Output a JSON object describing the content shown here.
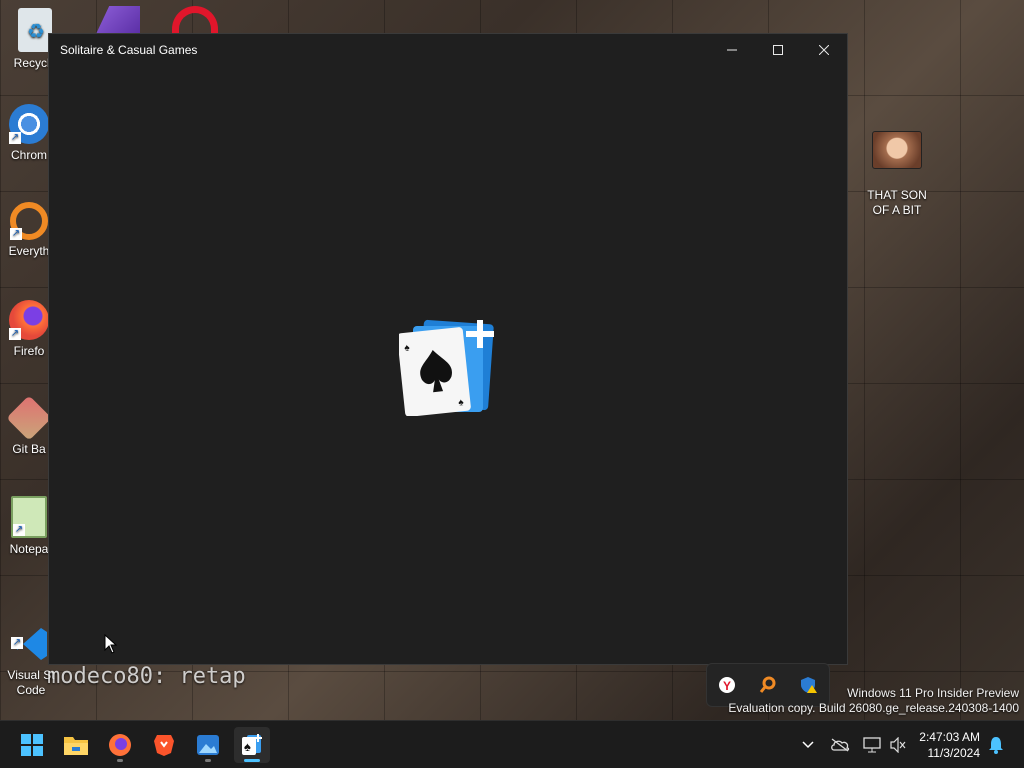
{
  "desktop": {
    "icons": [
      {
        "label": "Recycle",
        "icon": "recycle-bin-icon"
      },
      {
        "label": "Chrom",
        "icon": "chrome-icon"
      },
      {
        "label": "Everyth",
        "icon": "everything-search-icon"
      },
      {
        "label": "Firefo",
        "icon": "firefox-icon"
      },
      {
        "label": "Git Ba",
        "icon": "git-bash-icon"
      },
      {
        "label": "Notepa",
        "icon": "notepad-icon"
      },
      {
        "label": "Visual St\nCode",
        "icon": "vscode-icon"
      }
    ],
    "right_icon": {
      "label": "THAT SON\nOF A BIT",
      "icon": "photo-thumbnail-icon"
    }
  },
  "window": {
    "title": "Solitaire & Casual Games",
    "minimize_symbol": "—",
    "maximize_symbol": "☐",
    "close_symbol": "✕",
    "splash_icon": "solitaire-logo-icon"
  },
  "overlay_text": "modeco80: retap",
  "watermark": {
    "line1": "Windows 11 Pro Insider Preview",
    "line2": "Evaluation copy. Build 26080.ge_release.240308-1400"
  },
  "tray_flyout": {
    "icons": [
      "yandex-icon",
      "everything-search-icon",
      "defender-warning-icon"
    ]
  },
  "taskbar": {
    "apps": [
      {
        "name": "start-button",
        "icon": "windows-start-icon"
      },
      {
        "name": "file-explorer",
        "icon": "folder-icon"
      },
      {
        "name": "firefox",
        "icon": "firefox-icon"
      },
      {
        "name": "brave",
        "icon": "brave-icon"
      },
      {
        "name": "photos",
        "icon": "photos-icon"
      },
      {
        "name": "solitaire",
        "icon": "solitaire-icon"
      }
    ],
    "clock_time": "2:47:03 AM",
    "clock_date": "11/3/2024"
  },
  "colors": {
    "accent": "#4cc2ff",
    "window_bg": "#1f1f1f",
    "taskbar_bg": "#1c1c1c"
  }
}
